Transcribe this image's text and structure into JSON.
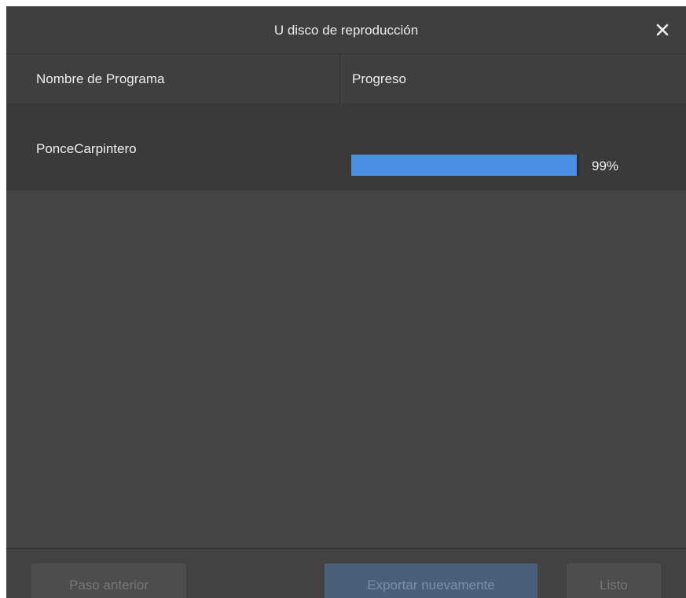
{
  "dialog": {
    "title": "U disco de reproducción",
    "close_icon": "close-icon"
  },
  "table": {
    "columns": [
      "Nombre de Programa",
      "Progreso"
    ],
    "rows": [
      {
        "name": "PonceCarpintero",
        "progress_fraction": 0.99,
        "progress_label": "99%"
      }
    ]
  },
  "footer": {
    "prev_label": "Paso anterior",
    "export_label": "Exportar nuevamente",
    "done_label": "Listo"
  },
  "colors": {
    "progress_fill": "#4a8ee6",
    "dialog_bg": "#454545"
  }
}
